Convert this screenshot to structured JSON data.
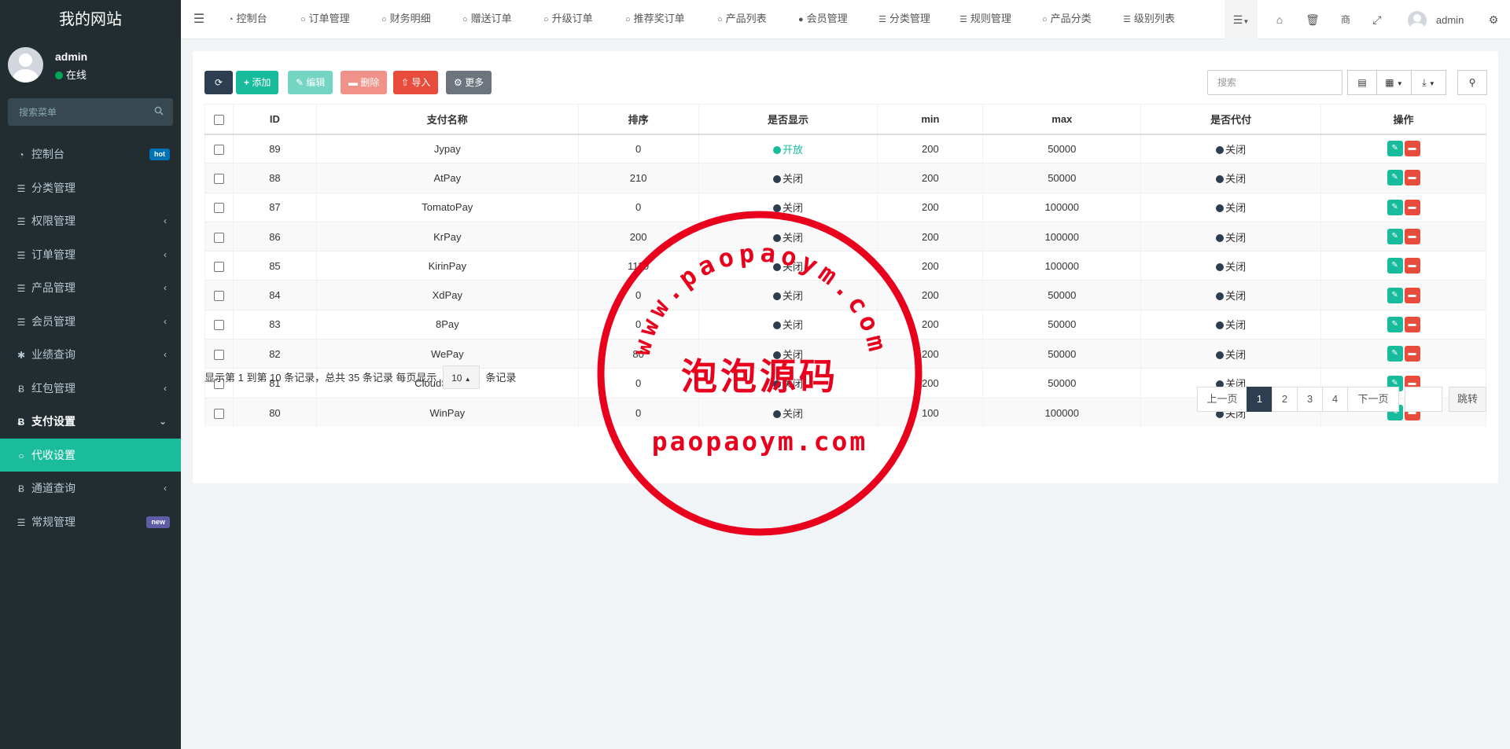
{
  "sidebar": {
    "brand": "我的网站",
    "user": {
      "name": "admin",
      "status": "在线"
    },
    "search_placeholder": "搜索菜单",
    "items": [
      {
        "label": "控制台",
        "icon": "dashboard-icon",
        "badge": "hot",
        "badge_color": "#0073b7"
      },
      {
        "label": "分类管理",
        "icon": "list-icon"
      },
      {
        "label": "权限管理",
        "icon": "list-icon",
        "has_children": true
      },
      {
        "label": "订单管理",
        "icon": "list-icon",
        "has_children": true
      },
      {
        "label": "产品管理",
        "icon": "list-icon",
        "has_children": true
      },
      {
        "label": "会员管理",
        "icon": "list-icon",
        "has_children": true
      },
      {
        "label": "业绩查询",
        "icon": "asterisk-icon",
        "has_children": true
      },
      {
        "label": "红包管理",
        "icon": "bitcoin-icon",
        "has_children": true
      },
      {
        "label": "支付设置",
        "icon": "bitcoin-icon",
        "expanded": true
      },
      {
        "label": "代收设置",
        "icon": "circle-icon",
        "active": true
      },
      {
        "label": "通道查询",
        "icon": "bitcoin-icon",
        "has_children": true
      },
      {
        "label": "常规管理",
        "icon": "list-icon",
        "badge": "new",
        "badge_color": "#605ca8"
      }
    ]
  },
  "topbar": {
    "tabs": [
      {
        "label": "控制台",
        "icon": "dashboard-icon"
      },
      {
        "label": "订单管理",
        "icon": "circle-icon"
      },
      {
        "label": "财务明细",
        "icon": "circle-icon"
      },
      {
        "label": "赠送订单",
        "icon": "circle-icon"
      },
      {
        "label": "升级订单",
        "icon": "circle-icon"
      },
      {
        "label": "推荐奖订单",
        "icon": "circle-icon"
      },
      {
        "label": "产品列表",
        "icon": "circle-icon"
      },
      {
        "label": "会员管理",
        "icon": "user-icon"
      },
      {
        "label": "分类管理",
        "icon": "list-icon"
      },
      {
        "label": "规则管理",
        "icon": "list-icon"
      },
      {
        "label": "产品分类",
        "icon": "circle-icon"
      },
      {
        "label": "级别列表",
        "icon": "list-icon"
      }
    ],
    "admin_name": "admin"
  },
  "toolbar": {
    "add": "添加",
    "edit": "编辑",
    "delete": "删除",
    "import": "导入",
    "more": "更多",
    "search_placeholder": "搜索"
  },
  "table": {
    "headers": [
      "ID",
      "支付名称",
      "排序",
      "是否显示",
      "min",
      "max",
      "是否代付",
      "操作"
    ],
    "rows": [
      {
        "id": "89",
        "name": "Jypay",
        "sort": "0",
        "show": "开放",
        "show_on": true,
        "min": "200",
        "max": "50000",
        "payout": "关闭"
      },
      {
        "id": "88",
        "name": "AtPay",
        "sort": "210",
        "show": "关闭",
        "show_on": false,
        "min": "200",
        "max": "50000",
        "payout": "关闭"
      },
      {
        "id": "87",
        "name": "TomatoPay",
        "sort": "0",
        "show": "关闭",
        "show_on": false,
        "min": "200",
        "max": "100000",
        "payout": "关闭"
      },
      {
        "id": "86",
        "name": "KrPay",
        "sort": "200",
        "show": "关闭",
        "show_on": false,
        "min": "200",
        "max": "100000",
        "payout": "关闭"
      },
      {
        "id": "85",
        "name": "KirinPay",
        "sort": "1110",
        "show": "关闭",
        "show_on": false,
        "min": "200",
        "max": "100000",
        "payout": "关闭"
      },
      {
        "id": "84",
        "name": "XdPay",
        "sort": "0",
        "show": "关闭",
        "show_on": false,
        "min": "200",
        "max": "50000",
        "payout": "关闭"
      },
      {
        "id": "83",
        "name": "8Pay",
        "sort": "0",
        "show": "关闭",
        "show_on": false,
        "min": "200",
        "max": "50000",
        "payout": "关闭"
      },
      {
        "id": "82",
        "name": "WePay",
        "sort": "80",
        "show": "关闭",
        "show_on": false,
        "min": "200",
        "max": "50000",
        "payout": "关闭"
      },
      {
        "id": "81",
        "name": "CloudSafePay",
        "sort": "0",
        "show": "关闭",
        "show_on": false,
        "min": "200",
        "max": "50000",
        "payout": "关闭"
      },
      {
        "id": "80",
        "name": "WinPay",
        "sort": "0",
        "show": "关闭",
        "show_on": false,
        "min": "100",
        "max": "100000",
        "payout": "关闭"
      }
    ]
  },
  "footer": {
    "info": "显示第 1 到第 10 条记录，总共 35 条记录 每页显示",
    "page_size": "10",
    "suffix": "条记录"
  },
  "pagination": {
    "prev": "上一页",
    "pages": [
      "1",
      "2",
      "3",
      "4"
    ],
    "current": "1",
    "next": "下一页",
    "jump": "跳转"
  },
  "watermark": {
    "arc_text": "www.paopaoym.com",
    "center_text": "泡泡源码",
    "bottom_text": "paopaoym.com",
    "color": "#e8001c"
  },
  "colors": {
    "sidebar_bg": "#222d32",
    "accent": "#1abc9c",
    "danger": "#e74c3c",
    "primary_dark": "#2c3e50"
  }
}
